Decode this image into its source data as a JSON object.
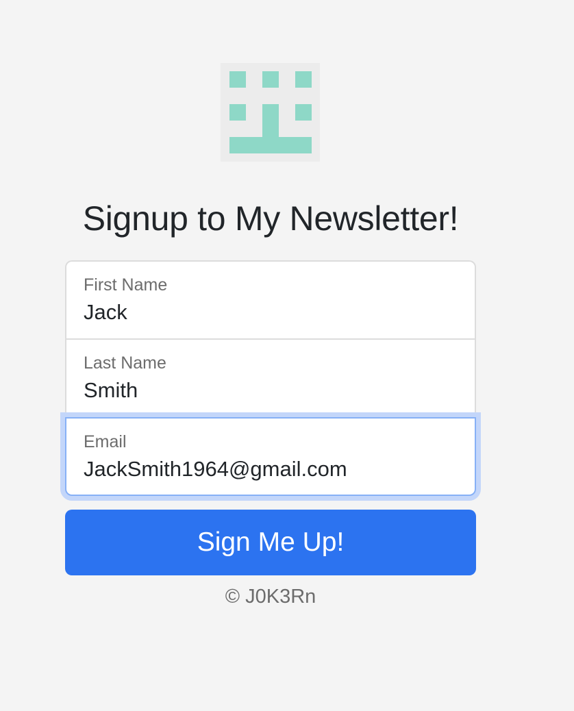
{
  "logo": {
    "icon": "pixel-face-logo",
    "color": "#8ed8c7",
    "background": "#ececec"
  },
  "heading": "Signup to My Newsletter!",
  "form": {
    "first_name": {
      "label": "First Name",
      "value": "Jack"
    },
    "last_name": {
      "label": "Last Name",
      "value": "Smith"
    },
    "email": {
      "label": "Email",
      "value": "JackSmith1964@gmail.com"
    },
    "submit_label": "Sign Me Up!"
  },
  "footer": {
    "copyright": "© J0K3Rn"
  },
  "colors": {
    "accent": "#2c73f0",
    "focus_ring": "#c3d6fa",
    "page_background": "#f4f4f4"
  }
}
